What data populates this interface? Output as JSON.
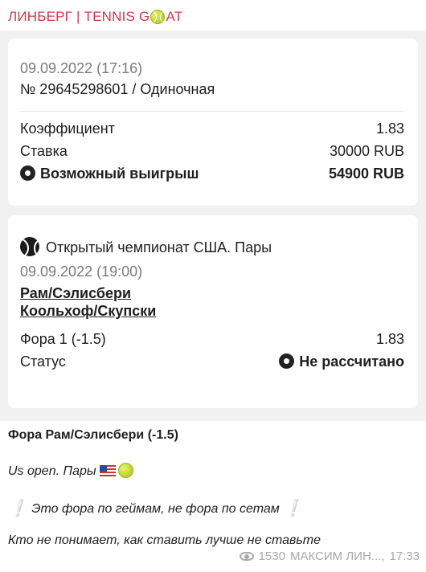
{
  "channel": {
    "name_part1": "ЛИНБЕРГ | TENNIS G",
    "ball_icon": "tennis-ball-icon",
    "name_part2": "AT",
    "color": "#d1384d"
  },
  "bet_card": {
    "datetime": "09.09.2022 (17:16)",
    "number_line": "№ 29645298601 / Одиночная",
    "coef_label": "Коэффициент",
    "coef_value": "1.83",
    "stake_label": "Ставка",
    "stake_value": "30000 RUB",
    "win_label": "Возможный выигрыш",
    "win_value": "54900 RUB"
  },
  "event_card": {
    "tournament": "Открытый чемпионат США. Пары",
    "datetime": "09.09.2022 (19:00)",
    "team1": "Рам/Сэлисбери",
    "team2": "Коольхоф/Скупски",
    "market_label": "Фора 1 (-1.5)",
    "market_value": "1.83",
    "status_label": "Статус",
    "status_value": "Не рассчитано"
  },
  "caption": {
    "title": "Фора Рам/Сэлисбери (-1.5)",
    "line2": "Us open. Пары",
    "line3": "Это фора по геймам, не фора по сетам",
    "line4": "Кто не понимает, как ставить лучше не ставьте"
  },
  "meta": {
    "views": "1530",
    "author": "МАКСИМ ЛИН...,",
    "time": "17:33"
  }
}
